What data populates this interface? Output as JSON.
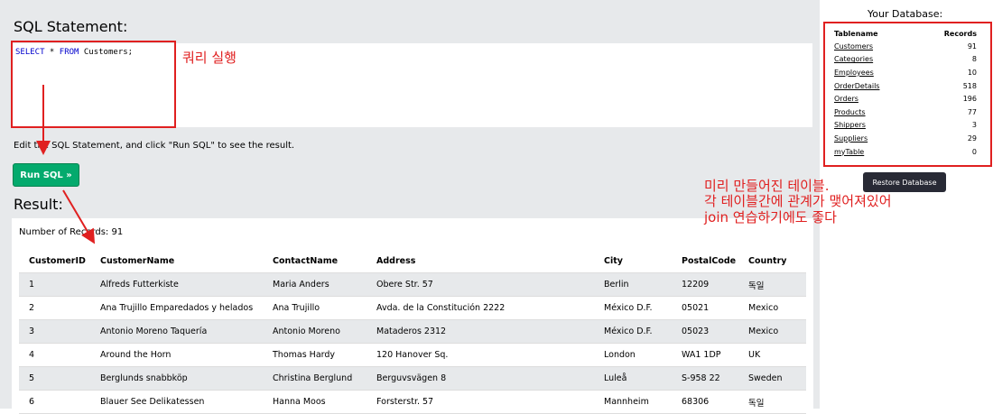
{
  "sql_section": {
    "title": "SQL Statement:",
    "code_keyword_1": "SELECT",
    "code_mid": " * ",
    "code_keyword_2": "FROM",
    "code_rest": " Customers;",
    "hint": "Edit the SQL Statement, and click \"Run SQL\" to see the result.",
    "run_button": "Run SQL »"
  },
  "result_section": {
    "title": "Result:",
    "record_count": "Number of Records: 91",
    "columns": [
      "CustomerID",
      "CustomerName",
      "ContactName",
      "Address",
      "City",
      "PostalCode",
      "Country"
    ],
    "rows": [
      [
        "1",
        "Alfreds Futterkiste",
        "Maria Anders",
        "Obere Str. 57",
        "Berlin",
        "12209",
        "독일"
      ],
      [
        "2",
        "Ana Trujillo Emparedados y helados",
        "Ana Trujillo",
        "Avda. de la Constitución 2222",
        "México D.F.",
        "05021",
        "Mexico"
      ],
      [
        "3",
        "Antonio Moreno Taquería",
        "Antonio Moreno",
        "Mataderos 2312",
        "México D.F.",
        "05023",
        "Mexico"
      ],
      [
        "4",
        "Around the Horn",
        "Thomas Hardy",
        "120 Hanover Sq.",
        "London",
        "WA1 1DP",
        "UK"
      ],
      [
        "5",
        "Berglunds snabbköp",
        "Christina Berglund",
        "Berguvsvägen 8",
        "Luleå",
        "S-958 22",
        "Sweden"
      ],
      [
        "6",
        "Blauer See Delikatessen",
        "Hanna Moos",
        "Forsterstr. 57",
        "Mannheim",
        "68306",
        "독일"
      ]
    ]
  },
  "database_panel": {
    "title": "Your Database:",
    "headers": [
      "Tablename",
      "Records"
    ],
    "tables": [
      {
        "name": "Customers",
        "records": "91"
      },
      {
        "name": "Categories",
        "records": "8"
      },
      {
        "name": "Employees",
        "records": "10"
      },
      {
        "name": "OrderDetails",
        "records": "518"
      },
      {
        "name": "Orders",
        "records": "196"
      },
      {
        "name": "Products",
        "records": "77"
      },
      {
        "name": "Shippers",
        "records": "3"
      },
      {
        "name": "Suppliers",
        "records": "29"
      },
      {
        "name": "myTable",
        "records": "0"
      }
    ],
    "restore_button": "Restore Database"
  },
  "annotations": {
    "query_note": "쿼리 실행",
    "db_note": "미리 만들어진 테이블.\n각 테이블간에 관계가 맺어져있어\njoin 연습하기에도 좋다"
  },
  "colors": {
    "annotation_red": "#e02020",
    "run_button": "#04aa6d",
    "restore_button": "#282a35",
    "panel_bg": "#e7e9eb"
  }
}
